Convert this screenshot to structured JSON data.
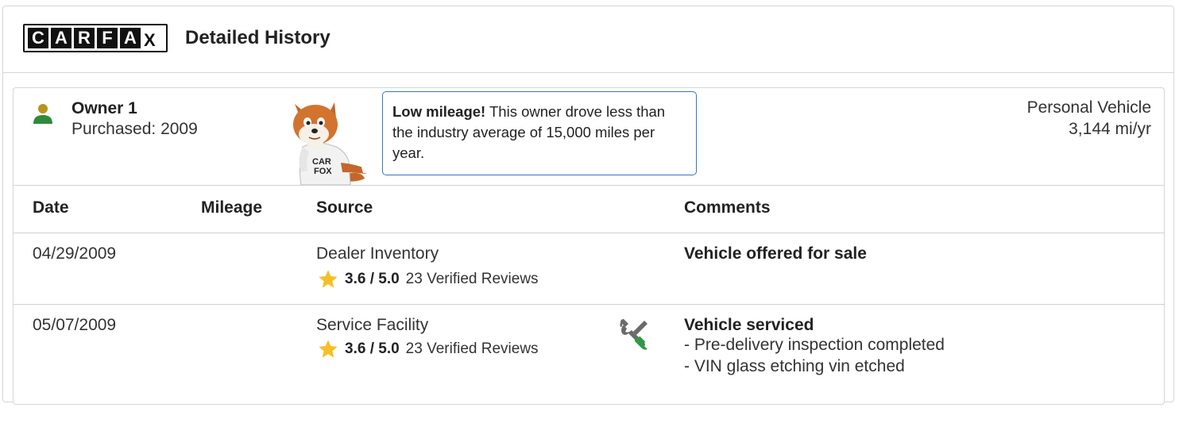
{
  "header": {
    "logo_letters": [
      "C",
      "A",
      "R",
      "F",
      "A",
      "X"
    ],
    "title": "Detailed History"
  },
  "owner": {
    "name": "Owner 1",
    "purchased": "Purchased: 2009",
    "icon": "person-icon"
  },
  "bubble": {
    "bold": "Low mileage!",
    "text": " This owner drove less than the industry average of 15,000 miles per year."
  },
  "vehicle": {
    "type": "Personal Vehicle",
    "miles": "3,144 mi/yr"
  },
  "table": {
    "headers": {
      "date": "Date",
      "mileage": "Mileage",
      "source": "Source",
      "comments": "Comments"
    },
    "rows": [
      {
        "date": "04/29/2009",
        "mileage": "",
        "source": "Dealer Inventory",
        "rating": "3.6 / 5.0",
        "reviews": "23 Verified Reviews",
        "comment_title": "Vehicle offered for sale",
        "comment_lines": []
      },
      {
        "date": "05/07/2009",
        "mileage": "",
        "source": "Service Facility",
        "rating": "3.6 / 5.0",
        "reviews": "23 Verified Reviews",
        "icon": "wrench-screwdriver-icon",
        "comment_title": "Vehicle serviced",
        "comment_lines": [
          "- Pre-delivery inspection completed",
          "- VIN glass etching vin etched"
        ]
      }
    ]
  },
  "colors": {
    "accent_blue": "#3777bc",
    "star": "#f6bf26",
    "owner_head": "#b8941f",
    "owner_body": "#2e8b3a",
    "tool_green": "#2e9a47"
  }
}
